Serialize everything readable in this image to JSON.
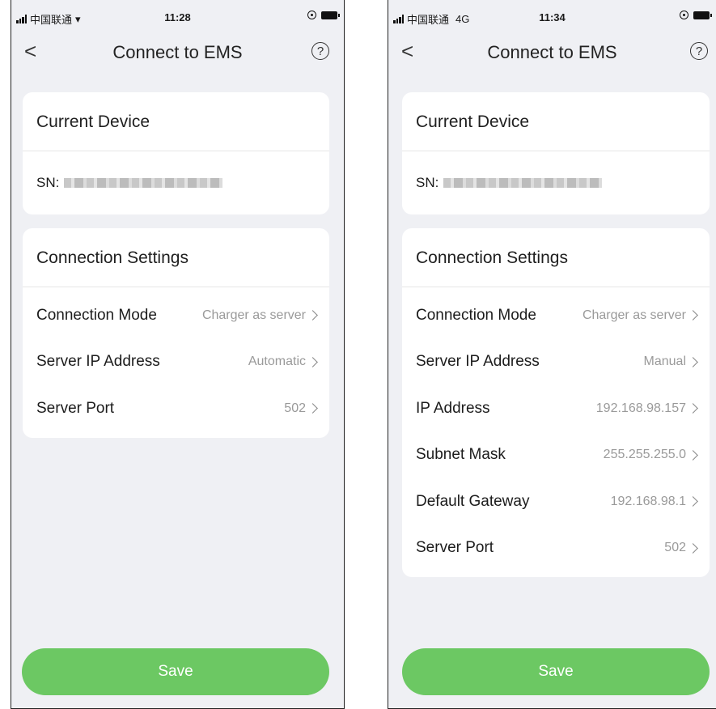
{
  "screens": [
    {
      "status": {
        "carrier": "中国联通",
        "network": "",
        "time": "11:28"
      },
      "nav": {
        "title": "Connect to EMS",
        "back_label": "<",
        "help_label": "?"
      },
      "current_device": {
        "heading": "Current Device",
        "sn_label": "SN:"
      },
      "connection_settings": {
        "heading": "Connection Settings",
        "rows": [
          {
            "label": "Connection Mode",
            "value": "Charger as server"
          },
          {
            "label": "Server IP Address",
            "value": "Automatic"
          },
          {
            "label": "Server Port",
            "value": "502"
          }
        ]
      },
      "save_label": "Save"
    },
    {
      "status": {
        "carrier": "中国联通",
        "network": "4G",
        "time": "11:34"
      },
      "nav": {
        "title": "Connect to EMS",
        "back_label": "<",
        "help_label": "?"
      },
      "current_device": {
        "heading": "Current Device",
        "sn_label": "SN:"
      },
      "connection_settings": {
        "heading": "Connection Settings",
        "rows": [
          {
            "label": "Connection Mode",
            "value": "Charger as server"
          },
          {
            "label": "Server IP Address",
            "value": "Manual"
          },
          {
            "label": "IP Address",
            "value": "192.168.98.157"
          },
          {
            "label": "Subnet Mask",
            "value": "255.255.255.0"
          },
          {
            "label": "Default Gateway",
            "value": "192.168.98.1"
          },
          {
            "label": "Server Port",
            "value": "502"
          }
        ]
      },
      "save_label": "Save"
    }
  ],
  "colors": {
    "accent": "#6cc863",
    "background": "#eff0f4",
    "card": "#ffffff",
    "muted_text": "#9a9a9a"
  }
}
